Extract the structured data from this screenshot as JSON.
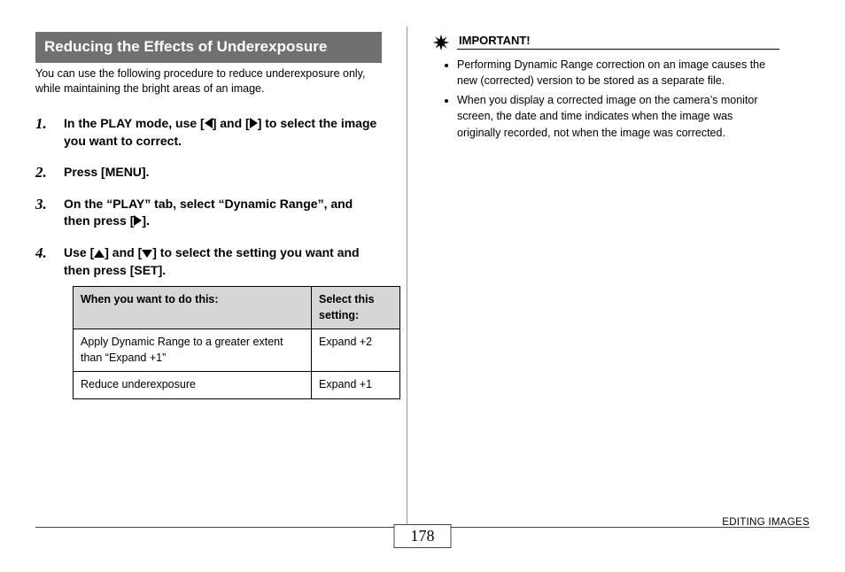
{
  "section": {
    "title": "Reducing the Effects of Underexposure",
    "intro": "You can use the following procedure to reduce underexposure only, while maintaining the bright areas of an image."
  },
  "steps": {
    "s1a": "In the PLAY mode, use [",
    "s1b": "] and [",
    "s1c": "] to select the image you want to correct.",
    "s2": "Press [MENU].",
    "s3a": "On the “PLAY” tab, select “Dynamic Range”, and then press [",
    "s3b": "].",
    "s4a": "Use [",
    "s4b": "] and [",
    "s4c": "] to select the setting you want and then press [SET]."
  },
  "table": {
    "h1": "When you want to do this:",
    "h2": "Select this setting:",
    "r1c1": "Apply Dynamic Range to a greater extent than “Expand +1”",
    "r1c2": "Expand +2",
    "r2c1": "Reduce underexposure",
    "r2c2": "Expand +1"
  },
  "important": {
    "label": "IMPORTANT!",
    "b1": "Performing Dynamic Range correction on an image causes the new (corrected) version to be stored as a separate file.",
    "b2": "When you display a corrected image on the camera’s monitor screen, the date and time indicates when the image was originally recorded, not when the image was corrected."
  },
  "footer": {
    "page": "178",
    "label": "EDITING IMAGES"
  }
}
